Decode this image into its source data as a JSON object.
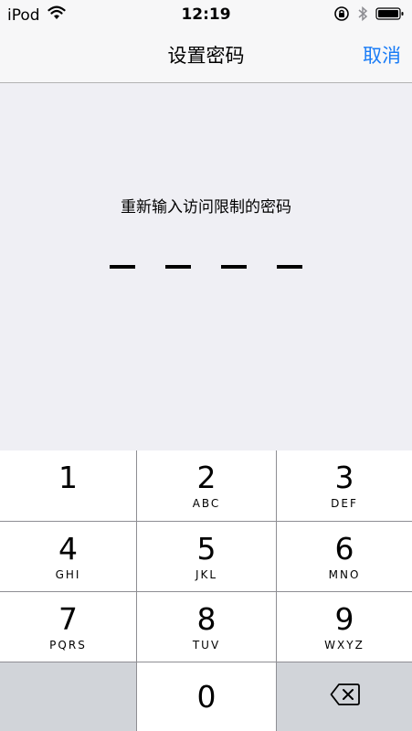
{
  "status_bar": {
    "carrier": "iPod",
    "time": "12:19",
    "wifi_icon": "wifi-icon",
    "lock_icon": "orientation-lock-icon",
    "bluetooth_icon": "bluetooth-icon",
    "battery_icon": "battery-icon"
  },
  "nav": {
    "title": "设置密码",
    "cancel_label": "取消"
  },
  "content": {
    "prompt": "重新输入访问限制的密码",
    "passcode_length": 4,
    "entered": 0
  },
  "keypad": {
    "keys": [
      {
        "digit": "1",
        "letters": ""
      },
      {
        "digit": "2",
        "letters": "ABC"
      },
      {
        "digit": "3",
        "letters": "DEF"
      },
      {
        "digit": "4",
        "letters": "GHI"
      },
      {
        "digit": "5",
        "letters": "JKL"
      },
      {
        "digit": "6",
        "letters": "MNO"
      },
      {
        "digit": "7",
        "letters": "PQRS"
      },
      {
        "digit": "8",
        "letters": "TUV"
      },
      {
        "digit": "9",
        "letters": "WXYZ"
      },
      {
        "digit": "0",
        "letters": ""
      }
    ],
    "delete_icon": "backspace-icon"
  },
  "colors": {
    "accent": "#1a7cf6",
    "background": "#efeff4",
    "keypad_separator": "#8e8e93",
    "dark_key": "#d1d4d9"
  }
}
